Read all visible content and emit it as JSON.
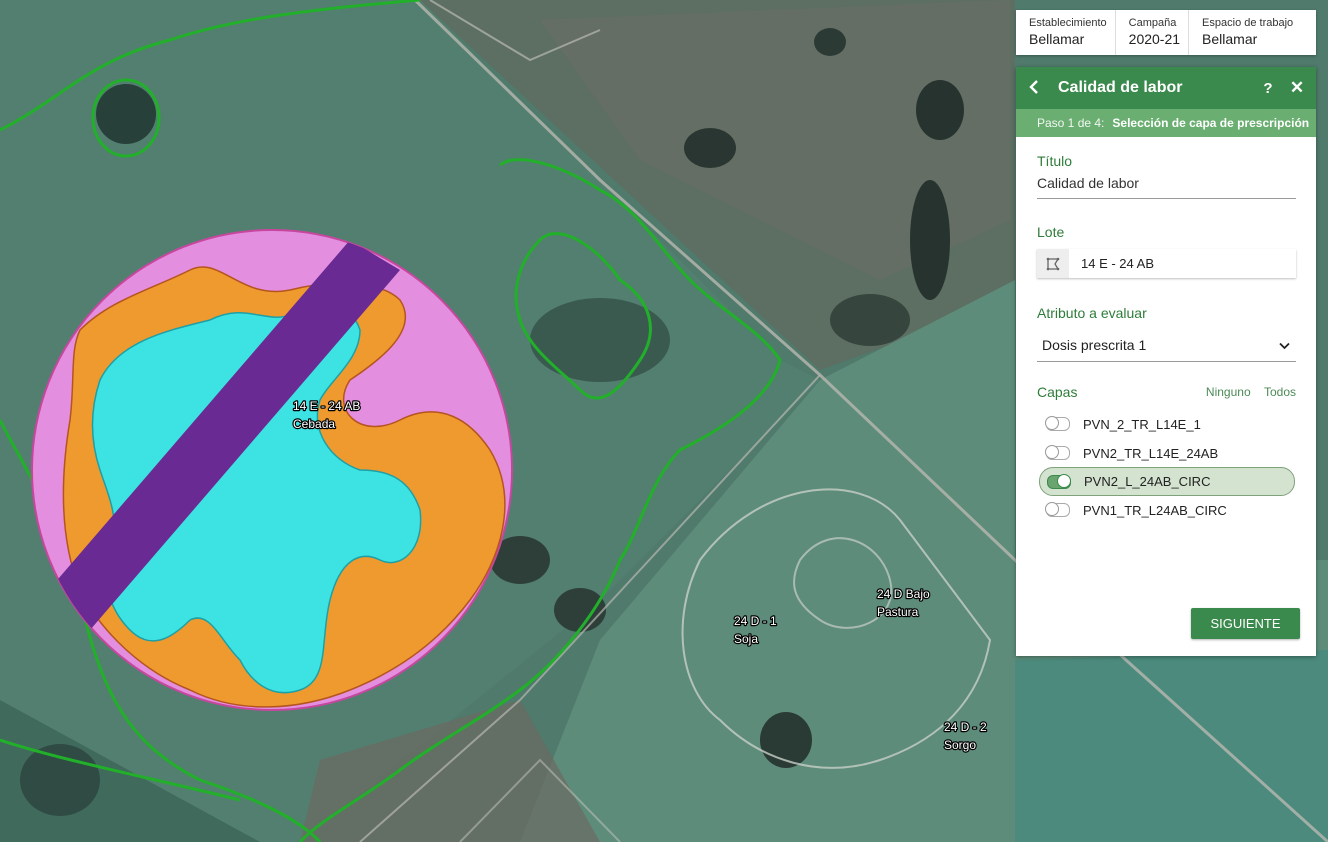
{
  "context": {
    "establecimiento": {
      "label": "Establecimiento",
      "value": "Bellamar"
    },
    "campana": {
      "label": "Campaña",
      "value": "2020-21"
    },
    "espacio": {
      "label": "Espacio de trabajo",
      "value": "Bellamar"
    }
  },
  "panel": {
    "title": "Calidad de labor",
    "help": "?",
    "close": "✕",
    "back": "‹",
    "step_prefix": "Paso 1 de 4:",
    "step_name": "Selección de capa de prescripción",
    "titulo_label": "Título",
    "titulo_value": "Calidad de labor",
    "lote_label": "Lote",
    "lote_value": "14 E - 24 AB",
    "atributo_label": "Atributo a evaluar",
    "atributo_value": "Dosis prescrita 1",
    "capas_label": "Capas",
    "ninguno": "Ninguno",
    "todos": "Todos",
    "layers": [
      {
        "name": "PVN_2_TR_L14E_1",
        "on": false
      },
      {
        "name": "PVN2_TR_L14E_24AB",
        "on": false
      },
      {
        "name": "PVN2_L_24AB_CIRC",
        "on": true
      },
      {
        "name": "PVN1_TR_L24AB_CIRC",
        "on": false
      }
    ],
    "next_button": "SIGUIENTE"
  },
  "map": {
    "labels": [
      {
        "line1": "14 E - 24 AB",
        "line2": "Cebada"
      },
      {
        "line1": "24 D - 1",
        "line2": "Soja"
      },
      {
        "line1": "24 D Bajo",
        "line2": "Pastura"
      },
      {
        "line1": "24 D - 2",
        "line2": "Sorgo"
      }
    ],
    "colors": {
      "zone_pink": "#e48ee0",
      "zone_orange": "#ef9a2e",
      "zone_cyan": "#3de3e3",
      "strip_purple": "#6a2a93",
      "field_outline": "#22b02a",
      "accent": "#3b8a4d"
    }
  }
}
